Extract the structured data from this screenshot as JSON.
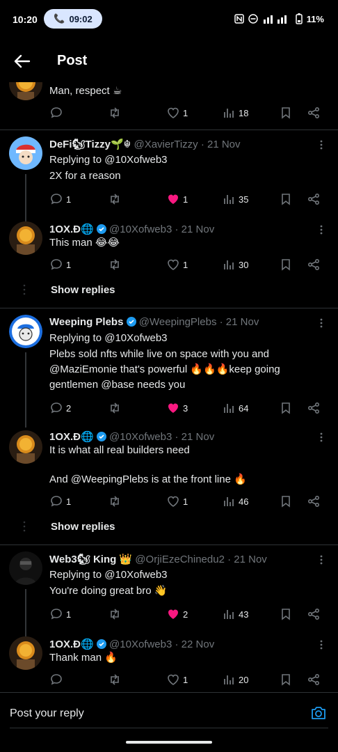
{
  "status_bar": {
    "time": "10:20",
    "call_time": "09:02",
    "battery": "11%"
  },
  "header": {
    "title": "Post"
  },
  "tweets": [
    {
      "body": "Man, respect ☕",
      "likes": "1",
      "views": "18"
    },
    {
      "display_name": "DeFi🐿Tizzy🌱☬",
      "handle": "@XavierTizzy",
      "date": "· 21 Nov",
      "replying_to": "Replying to @10Xofweb3",
      "body": "2X for a reason",
      "replies": "1",
      "likes": "1",
      "views": "35"
    },
    {
      "display_name": "1OX.Đ🌐",
      "handle": "@10Xofweb3",
      "date": "· 21 Nov",
      "body": "This man 😂😂",
      "replies": "1",
      "likes": "1",
      "views": "30"
    },
    {
      "display_name": "Weeping Plebs",
      "handle": "@WeepingPlebs",
      "date": "· 21 Nov",
      "replying_to": "Replying to @10Xofweb3",
      "body": "Plebs sold nfts while live on space with you and @MaziEmonie that's powerful 🔥🔥🔥keep going gentlemen @base needs you",
      "replies": "2",
      "likes": "3",
      "views": "64"
    },
    {
      "display_name": "1OX.Đ🌐",
      "handle": "@10Xofweb3",
      "date": "· 21 Nov",
      "body_line1": "It is what all real builders need",
      "body_line2": "And @WeepingPlebs is at the front line 🔥",
      "replies": "1",
      "likes": "1",
      "views": "46"
    },
    {
      "display_name": "Web3🐿 King 👑",
      "handle": "@OrjiEzeChinedu2",
      "date": "· 21 Nov",
      "replying_to": "Replying to @10Xofweb3",
      "body": "You're doing great bro 👋",
      "replies": "1",
      "likes": "2",
      "views": "43"
    },
    {
      "display_name": "1OX.Đ🌐",
      "handle": "@10Xofweb3",
      "date": "· 22 Nov",
      "body": "Thank man 🔥",
      "likes": "1",
      "views": "20"
    }
  ],
  "show_replies_label": "Show replies",
  "reply_bar": {
    "placeholder": "Post your reply"
  },
  "colors": {
    "background": "#000000",
    "text": "#e7e9ea",
    "muted": "#71767b",
    "liked": "#f91880",
    "verified": "#1d9bf0",
    "divider": "#2f3336"
  }
}
